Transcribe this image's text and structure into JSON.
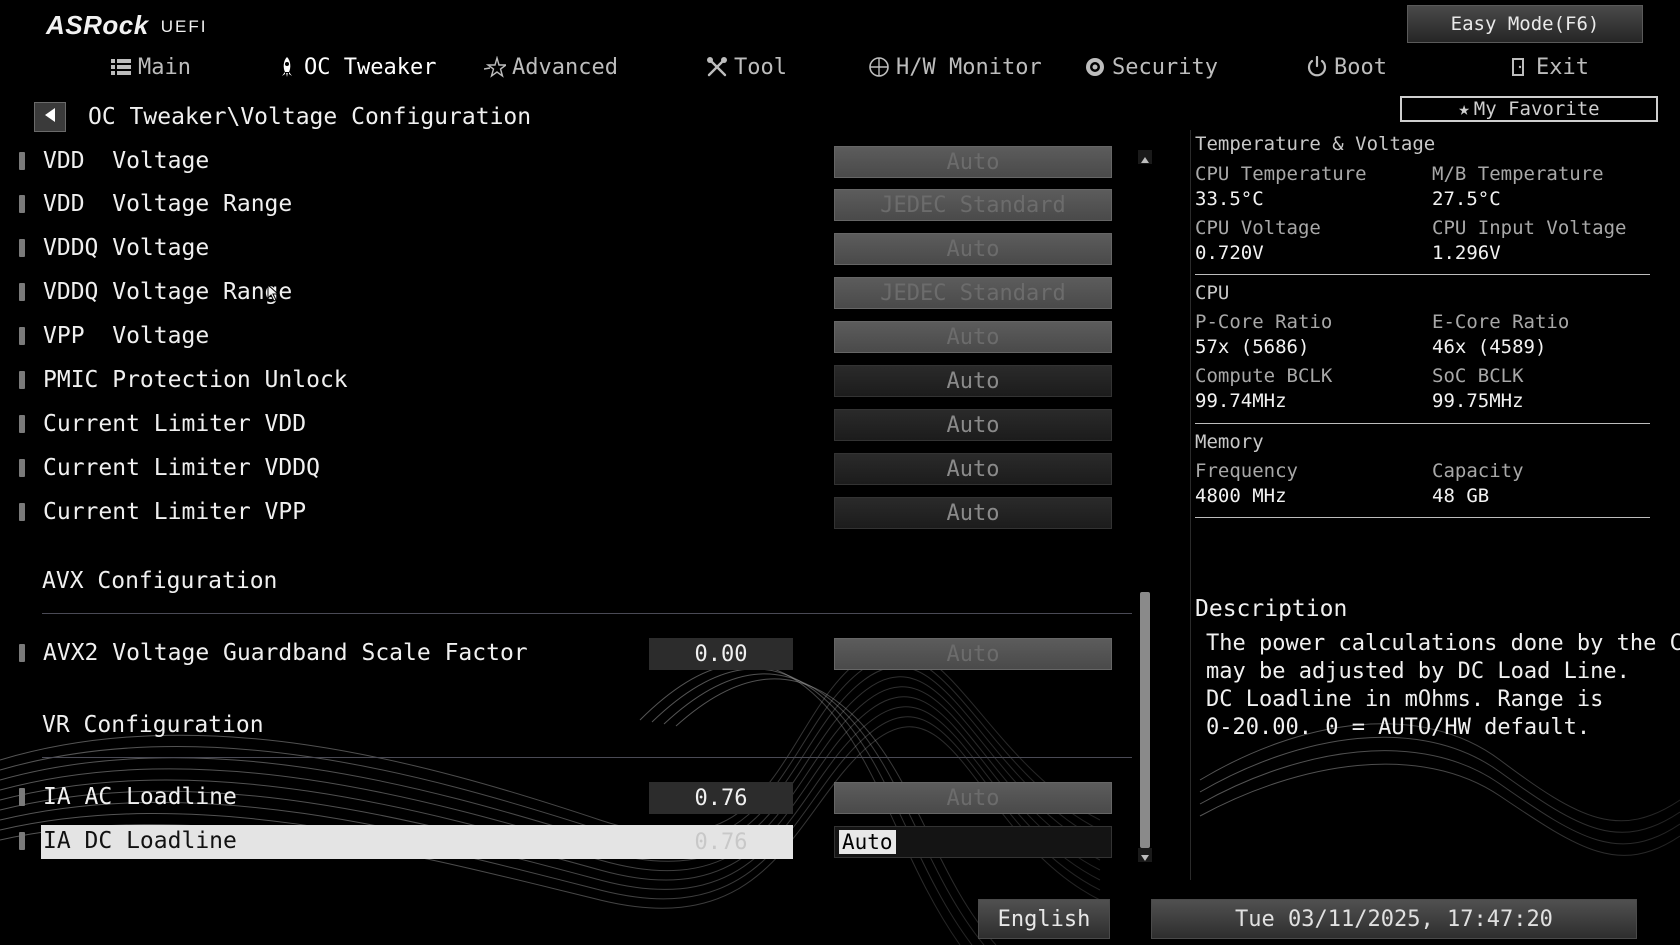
{
  "header": {
    "logo_brand": "ASRock",
    "logo_suffix": "UEFI",
    "easy_mode_label": "Easy Mode(F6)"
  },
  "nav": {
    "tabs": [
      {
        "label": "Main",
        "icon": "list-icon"
      },
      {
        "label": "OC Tweaker",
        "icon": "rocket-icon",
        "active": true
      },
      {
        "label": "Advanced",
        "icon": "star-icon"
      },
      {
        "label": "Tool",
        "icon": "wrench-icon"
      },
      {
        "label": "H/W Monitor",
        "icon": "monitor-icon"
      },
      {
        "label": "Security",
        "icon": "shield-icon"
      },
      {
        "label": "Boot",
        "icon": "power-icon"
      },
      {
        "label": "Exit",
        "icon": "exit-icon"
      }
    ]
  },
  "breadcrumb": "OC Tweaker\\Voltage Configuration",
  "settings": [
    {
      "label": "VDD  Voltage",
      "value": "Auto",
      "style": "disabled"
    },
    {
      "label": "VDD  Voltage Range",
      "value": "JEDEC Standard",
      "style": "disabled"
    },
    {
      "label": "VDDQ Voltage",
      "value": "Auto",
      "style": "disabled"
    },
    {
      "label": "VDDQ Voltage Range",
      "value": "JEDEC Standard",
      "style": "disabled"
    },
    {
      "label": "VPP  Voltage",
      "value": "Auto",
      "style": "disabled"
    },
    {
      "label": "PMIC Protection Unlock",
      "value": "Auto",
      "style": "dark"
    },
    {
      "label": "Current Limiter VDD",
      "value": "Auto",
      "style": "dark"
    },
    {
      "label": "Current Limiter VDDQ",
      "value": "Auto",
      "style": "dark"
    },
    {
      "label": "Current Limiter VPP",
      "value": "Auto",
      "style": "dark"
    }
  ],
  "sections": {
    "avx": "AVX Configuration",
    "vr": "VR Configuration"
  },
  "avx_setting": {
    "label": "AVX2 Voltage Guardband Scale Factor",
    "current": "0.00",
    "value": "Auto"
  },
  "vr_settings": [
    {
      "label": "IA AC Loadline",
      "current": "0.76",
      "value": "Auto"
    },
    {
      "label": "IA DC Loadline",
      "current": "0.76",
      "value": "Auto",
      "selected": true
    }
  ],
  "right_panel": {
    "favorite_label": "My Favorite",
    "temp_voltage": {
      "title": "Temperature & Voltage",
      "cpu_temp_label": "CPU Temperature",
      "cpu_temp": "33.5°C",
      "mb_temp_label": "M/B Temperature",
      "mb_temp": "27.5°C",
      "cpu_voltage_label": "CPU Voltage",
      "cpu_voltage": "0.720V",
      "cpu_input_voltage_label": "CPU Input Voltage",
      "cpu_input_voltage": "1.296V"
    },
    "cpu": {
      "title": "CPU",
      "pcore_label": "P-Core Ratio",
      "pcore": "57x (5686)",
      "ecore_label": "E-Core Ratio",
      "ecore": "46x (4589)",
      "compute_bclk_label": "Compute BCLK",
      "compute_bclk": "99.74MHz",
      "soc_bclk_label": "SoC BCLK",
      "soc_bclk": "99.75MHz"
    },
    "memory": {
      "title": "Memory",
      "freq_label": "Frequency",
      "freq": "4800 MHz",
      "capacity_label": "Capacity",
      "capacity": "48 GB"
    },
    "description": {
      "title": "Description",
      "lines": [
        "The power calculations done by the CPU",
        "may be adjusted by DC Load Line.",
        "DC Loadline in mOhms. Range is",
        "0-20.00. 0 = AUTO/HW default."
      ]
    }
  },
  "footer": {
    "language": "English",
    "datetime": "Tue 03/11/2025, 17:47:20"
  }
}
